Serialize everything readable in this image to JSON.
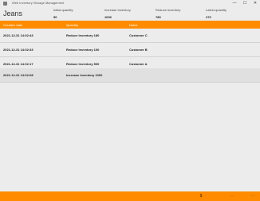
{
  "window": {
    "title": "Web Inventory Storage Management",
    "controls": {
      "minimize": "—",
      "maximize": "☐",
      "close": "✕"
    }
  },
  "product": {
    "name": "Jeans"
  },
  "stats": [
    {
      "label": "Initial quantity",
      "value": "50"
    },
    {
      "label": "Increase Inventory",
      "value": "1000"
    },
    {
      "label": "Reduce Inventory",
      "value": "780"
    },
    {
      "label": "Latest quantity",
      "value": "270"
    }
  ],
  "table": {
    "columns": [
      "Creation date",
      "Quantity",
      "Notes"
    ],
    "rows": [
      {
        "date": "2021-12-31 14:02:43",
        "quantity": "Reduce Inventory 180",
        "notes": "Customer C"
      },
      {
        "date": "2021-12-31 14:02:33",
        "quantity": "Reduce Inventory 100",
        "notes": "Customer B"
      },
      {
        "date": "2021-12-31 14:02:17",
        "quantity": "Reduce Inventory 500",
        "notes": "Customer A"
      },
      {
        "date": "2021-12-31 14:02:08",
        "quantity": "Increase Inventory 1000",
        "notes": ""
      }
    ],
    "selected_row": 3
  },
  "footer": {
    "icons": [
      "dollar-icon",
      "more-icon",
      "ellipsis-icon"
    ],
    "glyphs": {
      "dollar": "$",
      "more": "⋯",
      "ellipsis": "⋯"
    },
    "accent": "#ff8c00"
  }
}
